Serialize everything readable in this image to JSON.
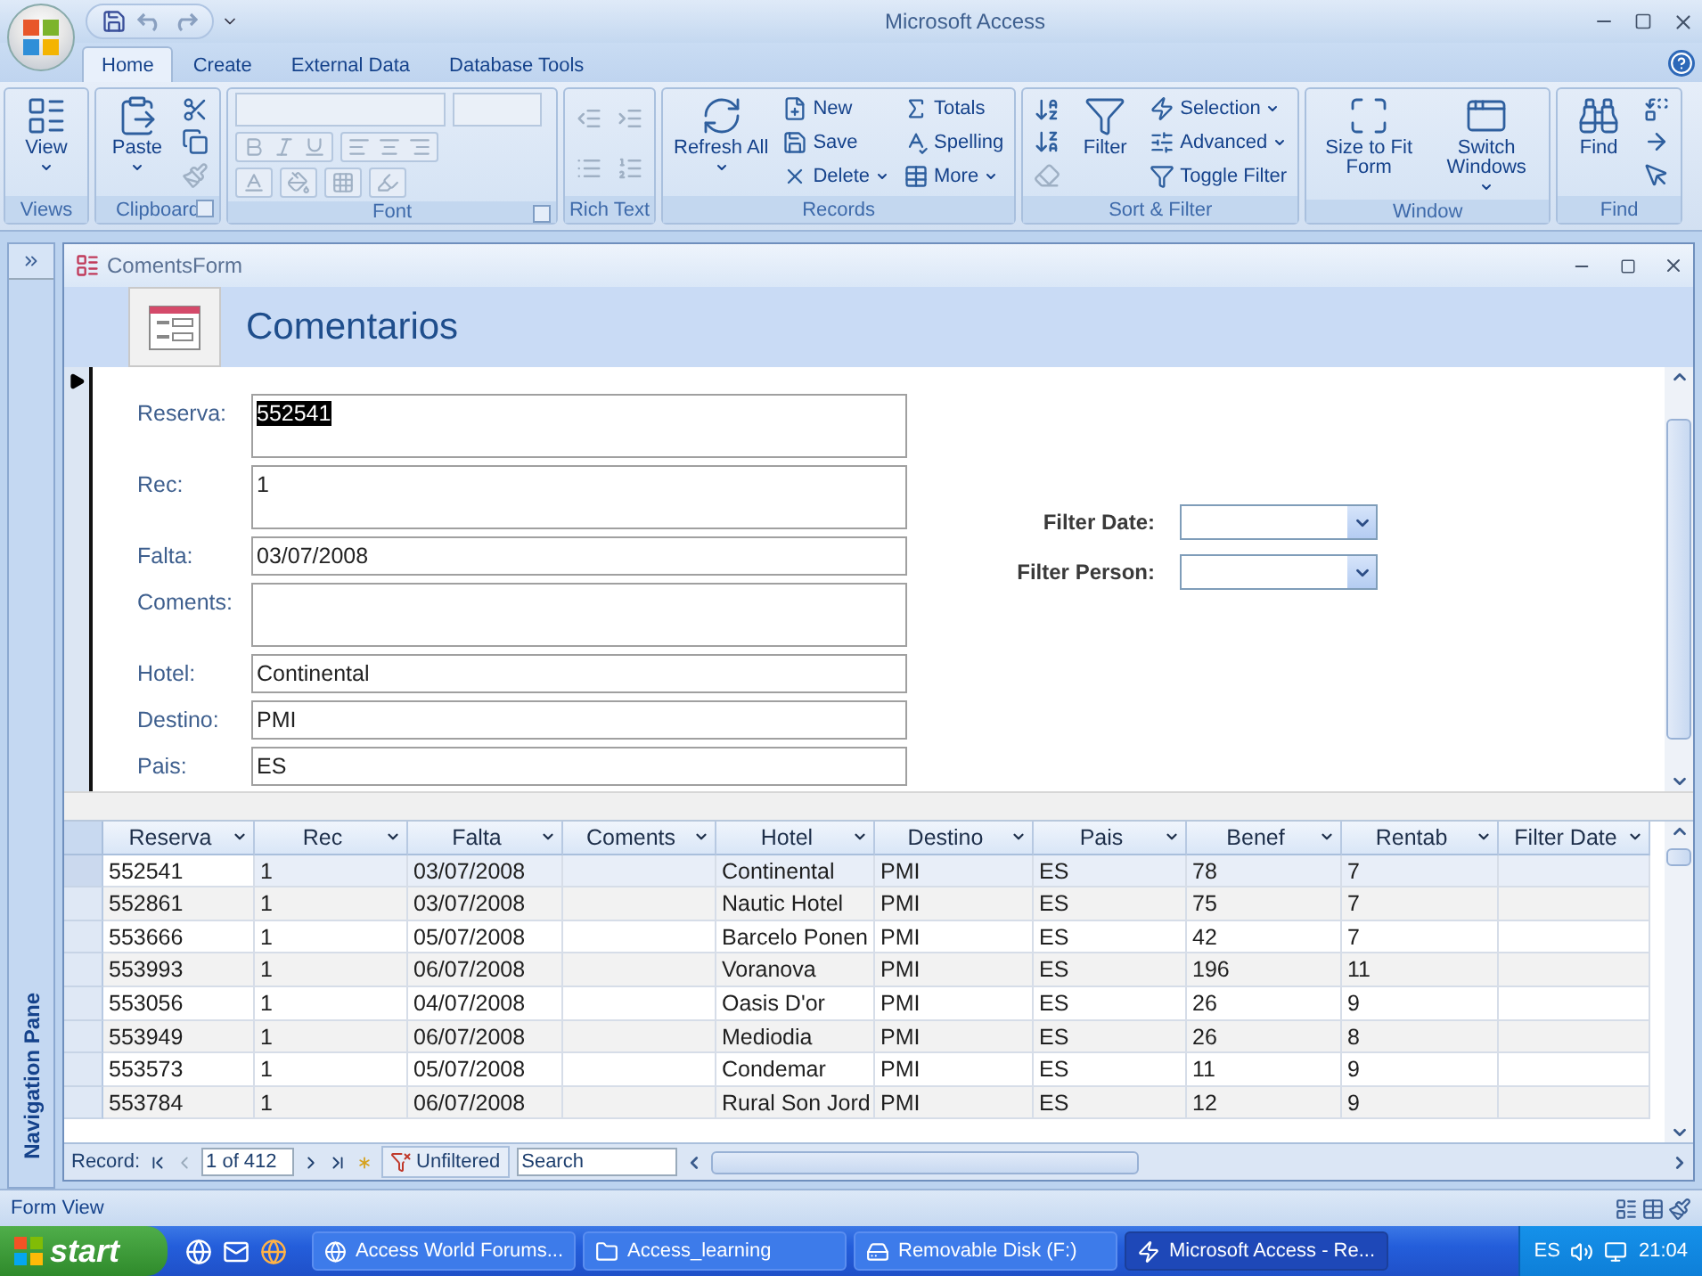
{
  "window": {
    "title": "Microsoft Access"
  },
  "tabs": [
    {
      "label": "Home",
      "selected": true
    },
    {
      "label": "Create",
      "selected": false
    },
    {
      "label": "External Data",
      "selected": false
    },
    {
      "label": "Database Tools",
      "selected": false
    }
  ],
  "ribbon": [
    {
      "label": "Views",
      "launcher": false,
      "items": [
        {
          "kind": "large",
          "label": "View",
          "dropdown": true,
          "disabled": false
        }
      ]
    },
    {
      "label": "Clipboard",
      "launcher": true,
      "items": [
        {
          "kind": "large",
          "label": "Paste",
          "dropdown": true,
          "disabled": false
        },
        {
          "kind": "stack",
          "buttons": [
            {
              "kind": "icon",
              "disabled": false
            },
            {
              "kind": "icon",
              "disabled": false
            },
            {
              "kind": "icon",
              "disabled": true
            }
          ]
        }
      ]
    },
    {
      "label": "Font",
      "launcher": true,
      "items": [
        {
          "kind": "fontpanel",
          "disabled": true
        }
      ]
    },
    {
      "label": "Rich Text",
      "launcher": false,
      "items": [
        {
          "kind": "stack",
          "buttons": [
            {
              "kind": "icon",
              "disabled": true
            },
            {
              "kind": "icon",
              "disabled": true
            }
          ]
        },
        {
          "kind": "stack",
          "buttons": [
            {
              "kind": "icon",
              "disabled": true
            },
            {
              "kind": "icon",
              "disabled": true
            }
          ]
        }
      ]
    },
    {
      "label": "Records",
      "launcher": false,
      "items": [
        {
          "kind": "large",
          "label": "Refresh All",
          "dropdown": true,
          "disabled": false
        },
        {
          "kind": "stack",
          "buttons": [
            {
              "kind": "small",
              "label": "New",
              "dropdown": false,
              "disabled": false
            },
            {
              "kind": "small",
              "label": "Save",
              "dropdown": false,
              "disabled": false
            },
            {
              "kind": "small",
              "label": "Delete",
              "dropdown": true,
              "disabled": false
            }
          ]
        },
        {
          "kind": "stack",
          "buttons": [
            {
              "kind": "small",
              "label": "Totals",
              "dropdown": false,
              "disabled": false
            },
            {
              "kind": "small",
              "label": "Spelling",
              "dropdown": false,
              "disabled": false
            },
            {
              "kind": "small",
              "label": "More",
              "dropdown": true,
              "disabled": false
            }
          ]
        }
      ]
    },
    {
      "label": "Sort & Filter",
      "launcher": false,
      "items": [
        {
          "kind": "stack",
          "buttons": [
            {
              "kind": "icon",
              "disabled": false
            },
            {
              "kind": "icon",
              "disabled": false
            },
            {
              "kind": "icon",
              "disabled": true
            }
          ]
        },
        {
          "kind": "large",
          "label": "Filter",
          "dropdown": false,
          "disabled": false
        },
        {
          "kind": "stack",
          "buttons": [
            {
              "kind": "small",
              "label": "Selection",
              "dropdown": true,
              "disabled": false
            },
            {
              "kind": "small",
              "label": "Advanced",
              "dropdown": true,
              "disabled": false
            },
            {
              "kind": "small",
              "label": "Toggle Filter",
              "dropdown": false,
              "disabled": false
            }
          ]
        }
      ]
    },
    {
      "label": "Window",
      "launcher": false,
      "items": [
        {
          "kind": "large",
          "label": "Size to Fit Form",
          "dropdown": false,
          "disabled": false
        },
        {
          "kind": "large",
          "label": "Switch Windows",
          "dropdown": true,
          "disabled": false
        }
      ]
    },
    {
      "label": "Find",
      "launcher": false,
      "items": [
        {
          "kind": "large",
          "label": "Find",
          "dropdown": false,
          "disabled": false
        },
        {
          "kind": "stack",
          "buttons": [
            {
              "kind": "icon",
              "disabled": false
            },
            {
              "kind": "icon",
              "disabled": false
            },
            {
              "kind": "icon",
              "disabled": false
            }
          ]
        }
      ]
    }
  ],
  "nav_pane": {
    "label": "Navigation Pane"
  },
  "form": {
    "title": "ComentsForm",
    "header": "Comentarios",
    "fields": [
      {
        "label": "Reserva:",
        "value": "552541",
        "tall": true,
        "highlighted": true
      },
      {
        "label": "Rec:",
        "value": "1",
        "tall": true,
        "highlighted": false
      },
      {
        "label": "Falta:",
        "value": "03/07/2008",
        "tall": false,
        "highlighted": false
      },
      {
        "label": "Coments:",
        "tall": true
      },
      {
        "label": "Hotel:",
        "value": "Continental",
        "tall": false,
        "highlighted": false
      },
      {
        "label": "Destino:",
        "value": "PMI",
        "tall": false,
        "highlighted": false
      },
      {
        "label": "Pais:",
        "value": "ES",
        "tall": false,
        "highlighted": false
      }
    ],
    "filters": [
      {
        "label": "Filter Date:"
      },
      {
        "label": "Filter Person:"
      }
    ],
    "datasheet": {
      "columns": [
        "Reserva",
        "Rec",
        "Falta",
        "Coments",
        "Hotel",
        "Destino",
        "Pais",
        "Benef",
        "Rentab",
        "Filter Date"
      ],
      "rows": [
        {
          "current": true,
          "cells": [
            "552541",
            "1",
            "03/07/2008",
            "",
            "Continental",
            "PMI",
            "ES",
            "78",
            "7",
            ""
          ]
        },
        {
          "current": false,
          "cells": [
            "552861",
            "1",
            "03/07/2008",
            "",
            "Nautic Hotel",
            "PMI",
            "ES",
            "75",
            "7",
            ""
          ]
        },
        {
          "current": false,
          "cells": [
            "553666",
            "1",
            "05/07/2008",
            "",
            "Barcelo Ponen",
            "PMI",
            "ES",
            "42",
            "7",
            ""
          ]
        },
        {
          "current": false,
          "cells": [
            "553993",
            "1",
            "06/07/2008",
            "",
            "Voranova",
            "PMI",
            "ES",
            "196",
            "11",
            ""
          ]
        },
        {
          "current": false,
          "cells": [
            "553056",
            "1",
            "04/07/2008",
            "",
            "Oasis D'or",
            "PMI",
            "ES",
            "26",
            "9",
            ""
          ]
        },
        {
          "current": false,
          "cells": [
            "553949",
            "1",
            "06/07/2008",
            "",
            "Mediodia",
            "PMI",
            "ES",
            "26",
            "8",
            ""
          ]
        },
        {
          "current": false,
          "cells": [
            "553573",
            "1",
            "05/07/2008",
            "",
            "Condemar",
            "PMI",
            "ES",
            "11",
            "9",
            ""
          ]
        },
        {
          "current": false,
          "cells": [
            "553784",
            "1",
            "06/07/2008",
            "",
            "Rural Son Jord",
            "PMI",
            "ES",
            "12",
            "9",
            ""
          ]
        }
      ]
    },
    "record_nav": {
      "label": "Record:",
      "position": "1 of 412",
      "filter": "Unfiltered",
      "search_placeholder": "Search"
    }
  },
  "status_bar": {
    "text": "Form View"
  },
  "taskbar": {
    "start": "start",
    "tasks": [
      {
        "label": "Access World Forums...",
        "selected": false
      },
      {
        "label": "Access_learning",
        "selected": false
      },
      {
        "label": "Removable Disk (F:)",
        "selected": false
      },
      {
        "label": "Microsoft Access - Re...",
        "selected": true
      }
    ],
    "language": "ES",
    "clock": "21:04"
  }
}
